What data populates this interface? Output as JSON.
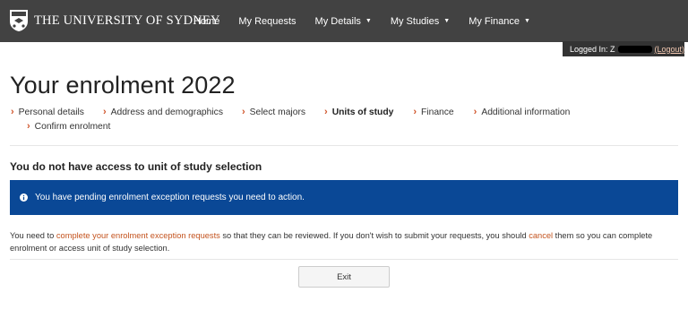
{
  "header": {
    "brand": "THE UNIVERSITY OF SYDNEY",
    "nav": [
      {
        "label": "Home",
        "dropdown": false
      },
      {
        "label": "My Requests",
        "dropdown": false
      },
      {
        "label": "My Details",
        "dropdown": true
      },
      {
        "label": "My Studies",
        "dropdown": true
      },
      {
        "label": "My Finance",
        "dropdown": true
      }
    ],
    "login": {
      "prefix": "Logged In: Z",
      "logout": "(Logout)"
    }
  },
  "page": {
    "title": "Your enrolment 2022"
  },
  "steps": [
    {
      "label": "Personal details",
      "current": false
    },
    {
      "label": "Address and demographics",
      "current": false
    },
    {
      "label": "Select majors",
      "current": false
    },
    {
      "label": "Units of study",
      "current": true
    },
    {
      "label": "Finance",
      "current": false
    },
    {
      "label": "Additional information",
      "current": false
    },
    {
      "label": "Confirm enrolment",
      "current": false
    }
  ],
  "section": {
    "heading": "You do not have access to unit of study selection"
  },
  "alert": {
    "text": "You have pending enrolment exception requests you need to action."
  },
  "body": {
    "p1": "You need to ",
    "link1": "complete your enrolment exception requests",
    "p2": " so that they can be reviewed. If you don't wish to submit your requests, you should ",
    "link2": "cancel",
    "p3": " them so you can complete enrolment or access unit of study selection."
  },
  "actions": {
    "exit": "Exit"
  },
  "colors": {
    "header_bg": "#424242",
    "alert_bg": "#0a4896",
    "accent": "#d0552b",
    "link": "#c4541f"
  }
}
